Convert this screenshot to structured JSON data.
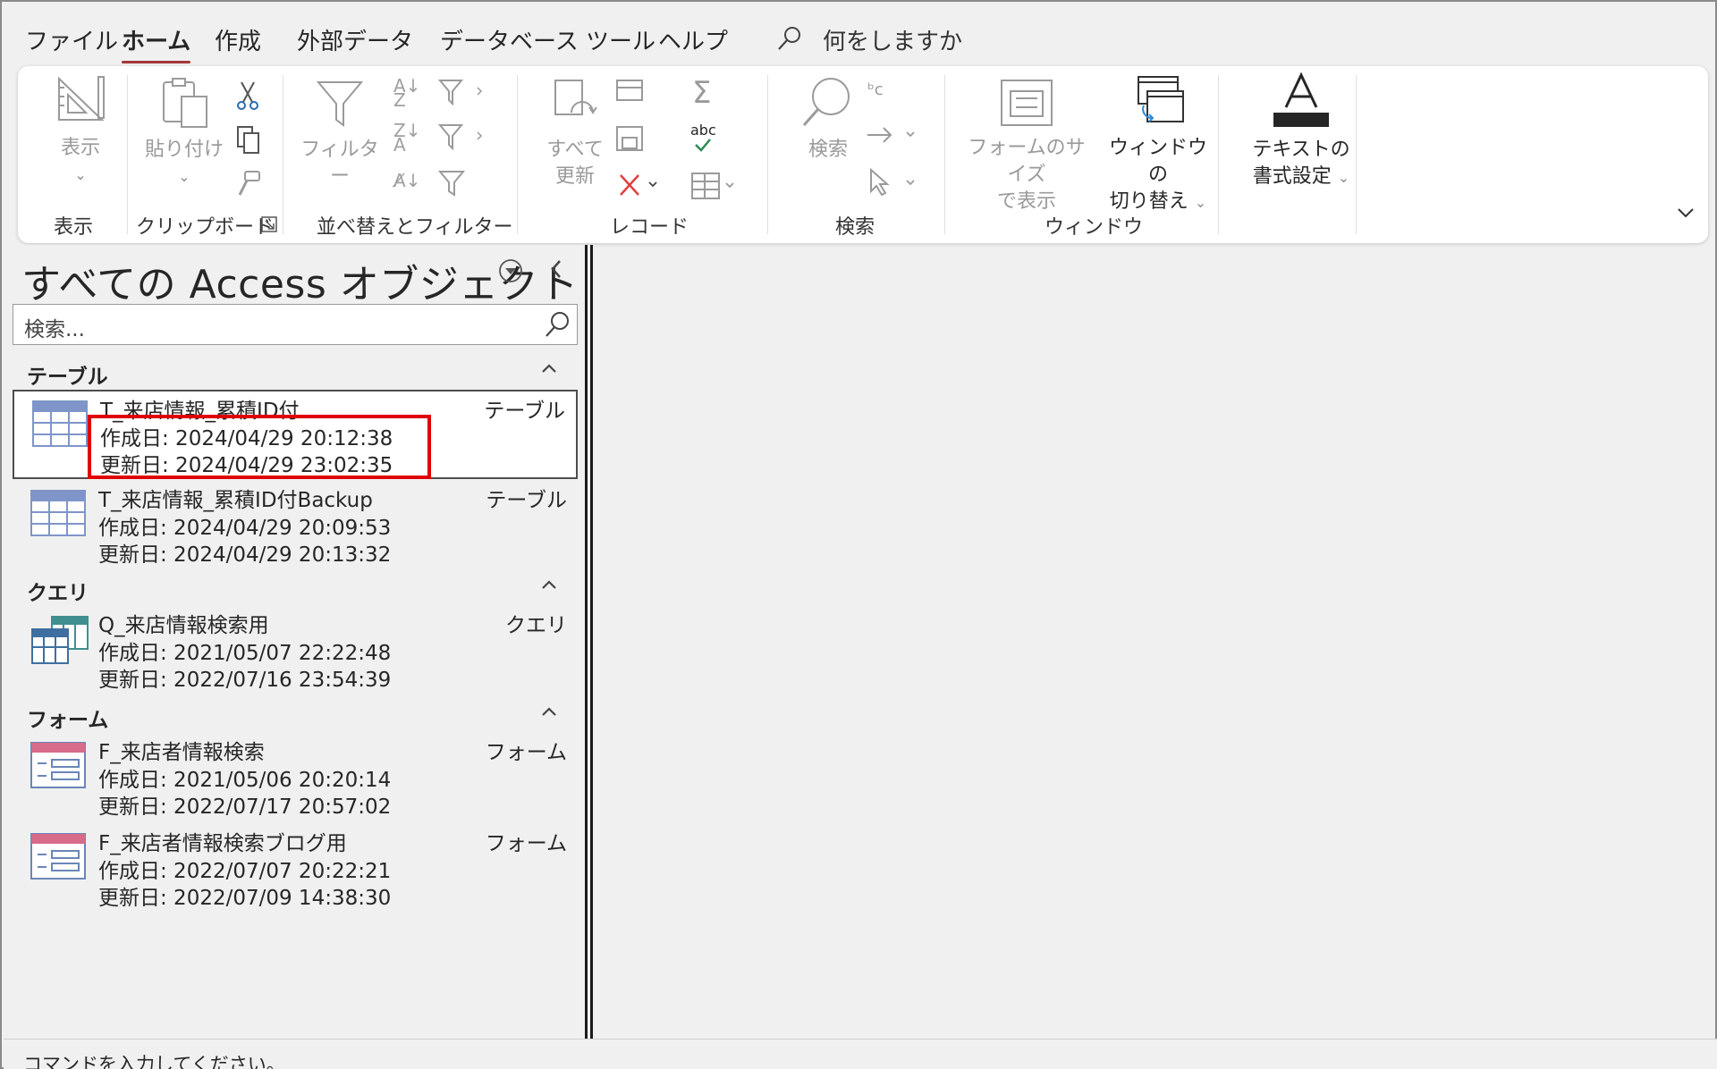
{
  "menu": {
    "tabs": [
      "ファイル",
      "ホーム",
      "作成",
      "外部データ",
      "データベース ツール",
      "ヘルプ"
    ],
    "active_tab": "ホーム",
    "tell_me": "何をしますか"
  },
  "ribbon": {
    "groups": {
      "view": "表示",
      "clipboard": "クリップボード",
      "sort_filter": "並べ替えとフィルター",
      "records": "レコード",
      "find": "検索",
      "window": "ウィンドウ"
    },
    "buttons": {
      "view": "表示",
      "paste": "貼り付け",
      "filter": "フィルター",
      "refresh_line1": "すべて",
      "refresh_line2": "更新",
      "find": "検索",
      "fit_form_line1": "フォームのサイズ",
      "fit_form_line2": "で表示",
      "switch_window_line1": "ウィンドウの",
      "switch_window_line2": "切り替え",
      "text_format_line1": "テキストの",
      "text_format_line2": "書式設定"
    },
    "spelling_label": "abc"
  },
  "nav": {
    "title": "すべての Access オブジェクト",
    "search_placeholder": "検索...",
    "categories": [
      {
        "label": "テーブル"
      },
      {
        "label": "クエリ"
      },
      {
        "label": "フォーム"
      }
    ],
    "objects": [
      {
        "name": "T_来店情報_累積ID付",
        "type": "テーブル",
        "created": "作成日: 2024/04/29 20:12:38",
        "updated": "更新日: 2024/04/29 23:02:35",
        "icon": "table-icon"
      },
      {
        "name": "T_来店情報_累積ID付Backup",
        "type": "テーブル",
        "created": "作成日: 2024/04/29 20:09:53",
        "updated": "更新日: 2024/04/29 20:13:32",
        "icon": "table-icon"
      },
      {
        "name": "Q_来店情報検索用",
        "type": "クエリ",
        "created": "作成日: 2021/05/07 22:22:48",
        "updated": "更新日: 2022/07/16 23:54:39",
        "icon": "query-icon"
      },
      {
        "name": "F_来店者情報検索",
        "type": "フォーム",
        "created": "作成日: 2021/05/06 20:20:14",
        "updated": "更新日: 2022/07/17 20:57:02",
        "icon": "form-icon"
      },
      {
        "name": "F_来店者情報検索ブログ用",
        "type": "フォーム",
        "created": "作成日: 2022/07/07 20:22:21",
        "updated": "更新日: 2022/07/09 14:38:30",
        "icon": "form-icon"
      }
    ]
  },
  "status": {
    "text": "コマンドを入力してください。"
  },
  "colors": {
    "accent": "#a4373a",
    "highlight": "#e00000",
    "table_icon": "#7f95c9",
    "form_icon": "#d76b8a",
    "query_icon": "#3f8f8f"
  }
}
